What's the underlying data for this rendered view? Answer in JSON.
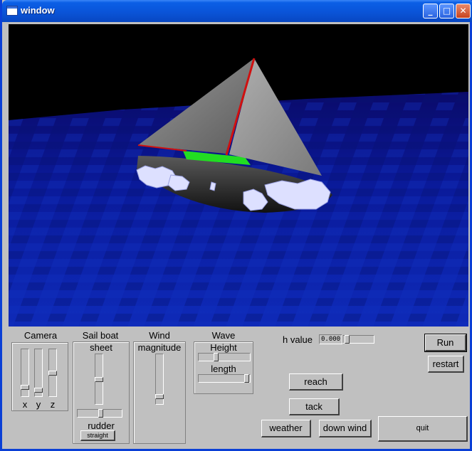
{
  "window": {
    "title": "window",
    "minimize_symbol": "_",
    "maximize_symbol": "□",
    "close_symbol": "✕"
  },
  "camera": {
    "title": "Camera",
    "sliders": [
      {
        "label": "x",
        "value": 0.85
      },
      {
        "label": "y",
        "value": 0.85
      },
      {
        "label": "z",
        "value": 0.5
      }
    ]
  },
  "sailboat": {
    "title": "Sail boat",
    "sheet_label": "sheet",
    "sheet_value": 0.5,
    "rudder_label": "rudder",
    "rudder_value": 0.5,
    "straight_label": "straight"
  },
  "wind": {
    "title": "Wind",
    "magnitude_label": "magnitude",
    "magnitude_value": 0.82
  },
  "wave": {
    "title": "Wave",
    "height_label": "Height",
    "height_value": 0.35,
    "length_label": "length",
    "length_value": 0.95
  },
  "hvalue": {
    "label": "h value",
    "text": "0.000",
    "slider_value": 0.05
  },
  "buttons": {
    "run": "Run",
    "restart": "restart",
    "reach": "reach",
    "tack": "tack",
    "weather": "weather",
    "down_wind": "down wind",
    "quit": "quit"
  },
  "colors": {
    "title_bar": "#0a54d8",
    "panel_bg": "#c0c0c0",
    "sea": "#0a1a9a",
    "sky": "#000000",
    "sail": "#8a8a8a",
    "mast": "#d01010",
    "deck": "#22dd22",
    "hull": "#202020"
  }
}
